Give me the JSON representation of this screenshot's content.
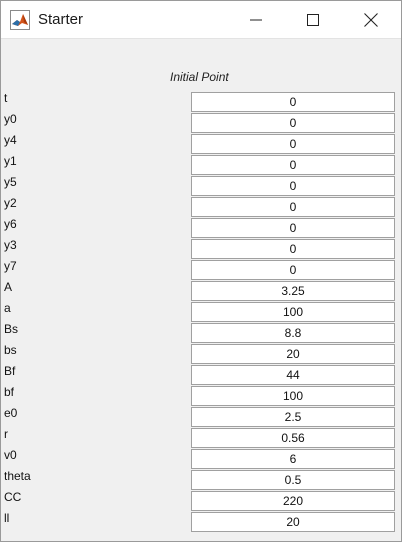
{
  "window": {
    "title": "Starter"
  },
  "header": {
    "column_label": "Initial Point"
  },
  "fields": [
    {
      "label": "t",
      "value": "0"
    },
    {
      "label": "y0",
      "value": "0"
    },
    {
      "label": "y4",
      "value": "0"
    },
    {
      "label": "y1",
      "value": "0"
    },
    {
      "label": "y5",
      "value": "0"
    },
    {
      "label": "y2",
      "value": "0"
    },
    {
      "label": "y6",
      "value": "0"
    },
    {
      "label": "y3",
      "value": "0"
    },
    {
      "label": "y7",
      "value": "0"
    },
    {
      "label": "A",
      "value": "3.25"
    },
    {
      "label": "a",
      "value": "100"
    },
    {
      "label": "Bs",
      "value": "8.8"
    },
    {
      "label": "bs",
      "value": "20"
    },
    {
      "label": "Bf",
      "value": "44"
    },
    {
      "label": "bf",
      "value": "100"
    },
    {
      "label": "e0",
      "value": "2.5"
    },
    {
      "label": "r",
      "value": "0.56"
    },
    {
      "label": "v0",
      "value": "6"
    },
    {
      "label": "theta",
      "value": "0.5"
    },
    {
      "label": "CC",
      "value": "220"
    },
    {
      "label": "ll",
      "value": "20"
    }
  ]
}
